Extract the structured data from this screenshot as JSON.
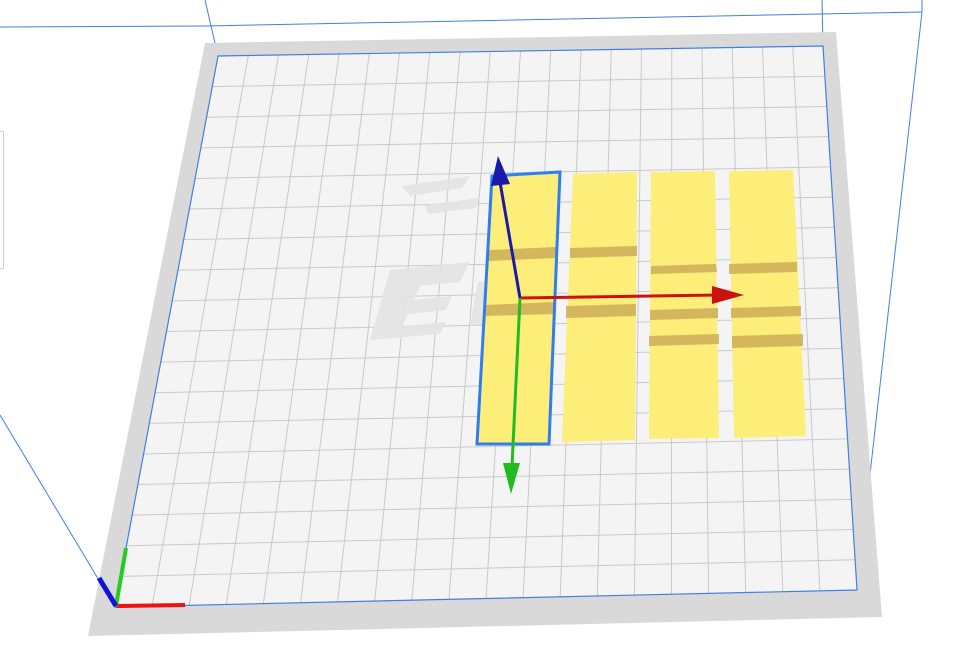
{
  "viewport": {
    "background_color": "#ffffff",
    "build_volume_line_color": "#3f7fe6"
  },
  "build_plate": {
    "frame_color": "#d9d9d9",
    "surface_color": "#f4f4f4",
    "grid_line_color": "#c9c9c9",
    "grid_columns": 20,
    "grid_rows": 18,
    "logo_color": "#e4e4e4"
  },
  "models": {
    "count": 4,
    "selected_index": 0,
    "fill_color": "#fcee78",
    "band_color": "#c9a756",
    "selection_outline_color": "#2f7df0"
  },
  "transform_gizmo": {
    "x_axis_color": "#cc1111",
    "y_axis_color": "#22bb22",
    "z_axis_color": "#1a1aaa",
    "x_axis_icon": "x-arrow-icon",
    "y_axis_icon": "y-arrow-icon",
    "z_axis_icon": "z-arrow-icon"
  },
  "origin_indicator": {
    "x_color": "#ee1111",
    "y_color": "#22cc22",
    "z_color": "#1111dd"
  }
}
